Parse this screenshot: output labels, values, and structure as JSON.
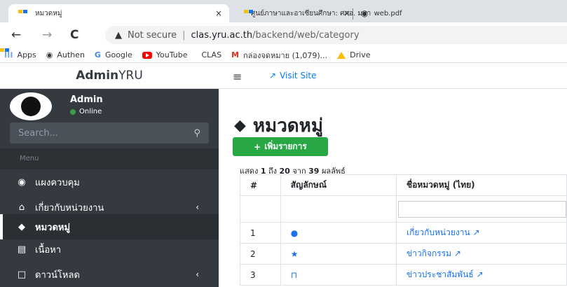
{
  "browser": {
    "tabs": [
      {
        "title": "หมวดหมู่",
        "active": true
      },
      {
        "title": "ศูนย์ภาษาและอาเซียนศึกษา: ศภอ. มหา"
      },
      {
        "title": "web.pdf"
      }
    ],
    "tab_close_glyph": "×",
    "url": {
      "security_label": "Not secure",
      "host": "clas.yru.ac.th",
      "path": "/backend/web/category"
    },
    "bookmarks": [
      {
        "label": "Apps",
        "icon": "apps-grid-icon"
      },
      {
        "label": "Authen",
        "icon": "github-icon"
      },
      {
        "label": "Google",
        "icon": "google-icon"
      },
      {
        "label": "YouTube",
        "icon": "youtube-icon"
      },
      {
        "label": "CLAS",
        "icon": "yru-icon"
      },
      {
        "label": "กล่องจดหมาย (1,079)...",
        "icon": "gmail-icon"
      },
      {
        "label": "Drive",
        "icon": "drive-icon"
      }
    ]
  },
  "app": {
    "brand_bold": "Admin",
    "brand_rest": "YRU",
    "user": {
      "name": "Admin",
      "status": "Online"
    },
    "search_placeholder": "Search...",
    "menu_header": "Menu",
    "menu": [
      {
        "label": "แผงควบคุม",
        "icon": "dashboard-icon"
      },
      {
        "label": "เกี่ยวกับหน่วยงาน",
        "icon": "institution-icon",
        "has_children": true
      },
      {
        "label": "หมวดหมู่",
        "icon": "tags-icon",
        "active": true
      },
      {
        "label": "เนื้อหา",
        "icon": "newspaper-icon"
      },
      {
        "label": "ดาวน์โหลด",
        "icon": "file-icon",
        "has_children": true
      }
    ],
    "visit_site": "Visit Site",
    "page_title": "หมวดหมู่",
    "add_button": "เพิ่มรายการ",
    "summary": {
      "prefix": "แสดง",
      "from": "1",
      "mid1": "ถึง",
      "to": "20",
      "mid2": "จาก",
      "total": "39",
      "suffix": "ผลลัพธ์"
    },
    "table": {
      "columns": [
        "#",
        "สัญลักษณ์",
        "ชื่อหมวดหมู่ (ไทย)"
      ],
      "rows": [
        {
          "num": "1",
          "icon": "globe-icon",
          "name": "เกี่ยวกับหน่วยงาน"
        },
        {
          "num": "2",
          "icon": "star-icon",
          "name": "ข่าวกิจกรรม"
        },
        {
          "num": "3",
          "icon": "bookmark-icon",
          "name": "ข่าวประชาสัมพันธ์"
        }
      ]
    }
  }
}
